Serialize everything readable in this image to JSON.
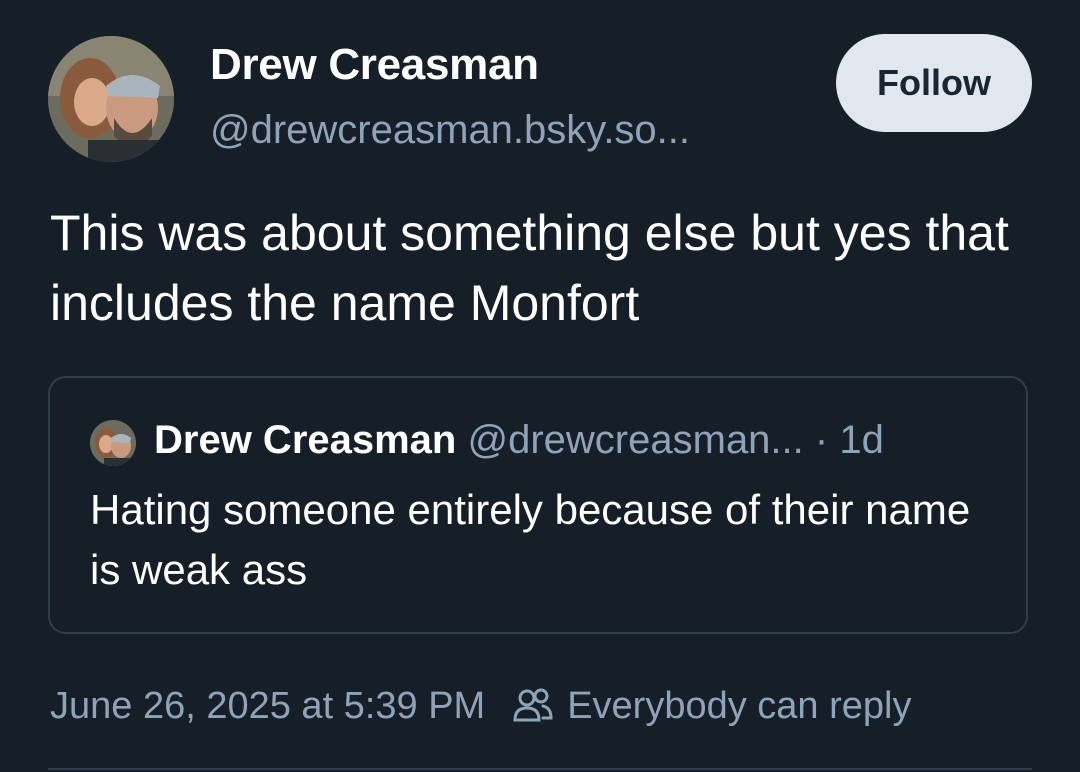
{
  "post": {
    "author": {
      "display_name": "Drew Creasman",
      "handle": "@drewcreasman.bsky.so..."
    },
    "follow_label": "Follow",
    "text": "This was about something else but yes that includes the name Monfort",
    "quoted": {
      "display_name": "Drew Creasman",
      "handle": "@drewcreasman...",
      "separator": " · ",
      "age": "1d",
      "text": "Hating someone entirely because of their name is weak ass"
    },
    "timestamp": "June 26, 2025 at 5:39 PM",
    "reply_setting": "Everybody can reply"
  },
  "icons": {
    "reply_setting": "people-icon"
  },
  "colors": {
    "background": "#161e27",
    "muted_text": "#8fa3b8",
    "follow_button_bg": "#e1e7ee",
    "border": "#2f3e4d"
  }
}
